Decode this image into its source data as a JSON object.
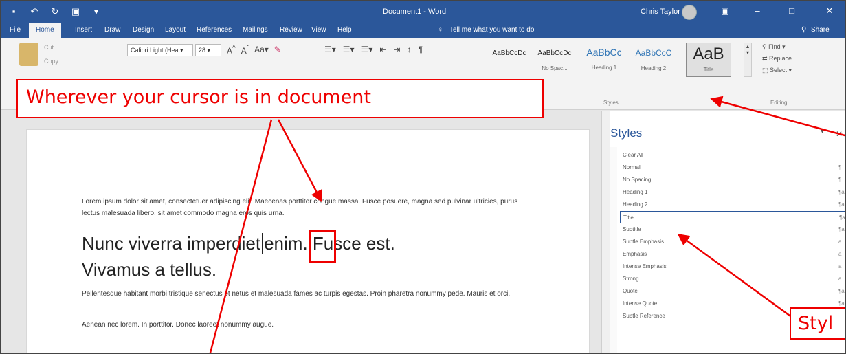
{
  "titlebar": {
    "document_title": "Document1  -  Word",
    "user_name": "Chris Taylor"
  },
  "tabs": [
    "File",
    "Home",
    "Insert",
    "Draw",
    "Design",
    "Layout",
    "References",
    "Mailings",
    "Review",
    "View",
    "Help"
  ],
  "tell_me": "Tell me what you want to do",
  "share": "Share",
  "ribbon": {
    "clipboard": {
      "cut": "Cut",
      "copy": "Copy"
    },
    "font_name": "Calibri Light (Hea",
    "font_size": "28",
    "styles_gallery": [
      {
        "sample": "AaBbCcDc",
        "name": ""
      },
      {
        "sample": "AaBbCcDc",
        "name": "No Spac..."
      },
      {
        "sample": "AaBbCc",
        "name": "Heading 1"
      },
      {
        "sample": "AaBbCcC",
        "name": "Heading 2"
      },
      {
        "sample": "AaB",
        "name": "Title"
      }
    ],
    "editing": {
      "find": "Find",
      "replace": "Replace",
      "select": "Select"
    },
    "group_styles": "Styles",
    "group_editing": "Editing"
  },
  "document": {
    "para1": "Lorem ipsum dolor sit amet, consectetuer adipiscing elit. Maecenas porttitor congue massa. Fusce posuere, magna sed pulvinar ultricies, purus lectus malesuada libero, sit amet commodo magna eros quis urna.",
    "title_line1_before": "Nunc viverra imperdiet",
    "title_line1_after": "enim. Fusce est.",
    "title_line2": "Vivamus a tellus.",
    "para2": "Pellentesque habitant morbi tristique senectus et netus et malesuada fames ac turpis egestas. Proin pharetra nonummy pede. Mauris et orci.",
    "para3": "Aenean nec lorem. In porttitor. Donec laoreet nonummy augue."
  },
  "styles_pane": {
    "title": "Styles",
    "items": [
      {
        "name": "Clear All",
        "glyph": ""
      },
      {
        "name": "Normal",
        "glyph": "¶"
      },
      {
        "name": "No Spacing",
        "glyph": "¶"
      },
      {
        "name": "Heading 1",
        "glyph": "¶a"
      },
      {
        "name": "Heading 2",
        "glyph": "¶a"
      },
      {
        "name": "Title",
        "glyph": "¶a",
        "selected": true
      },
      {
        "name": "Subtitle",
        "glyph": "¶a"
      },
      {
        "name": "Subtle Emphasis",
        "glyph": "a"
      },
      {
        "name": "Emphasis",
        "glyph": "a"
      },
      {
        "name": "Intense Emphasis",
        "glyph": "a"
      },
      {
        "name": "Strong",
        "glyph": "a"
      },
      {
        "name": "Quote",
        "glyph": "¶a"
      },
      {
        "name": "Intense Quote",
        "glyph": "¶a"
      },
      {
        "name": "Subtle Reference",
        "glyph": "a"
      }
    ]
  },
  "annotations": {
    "cursor_callout": "Wherever your cursor is in document",
    "style_callout": "Styl"
  },
  "colors": {
    "word_blue": "#2b579a",
    "annotation_red": "#ee0000"
  }
}
